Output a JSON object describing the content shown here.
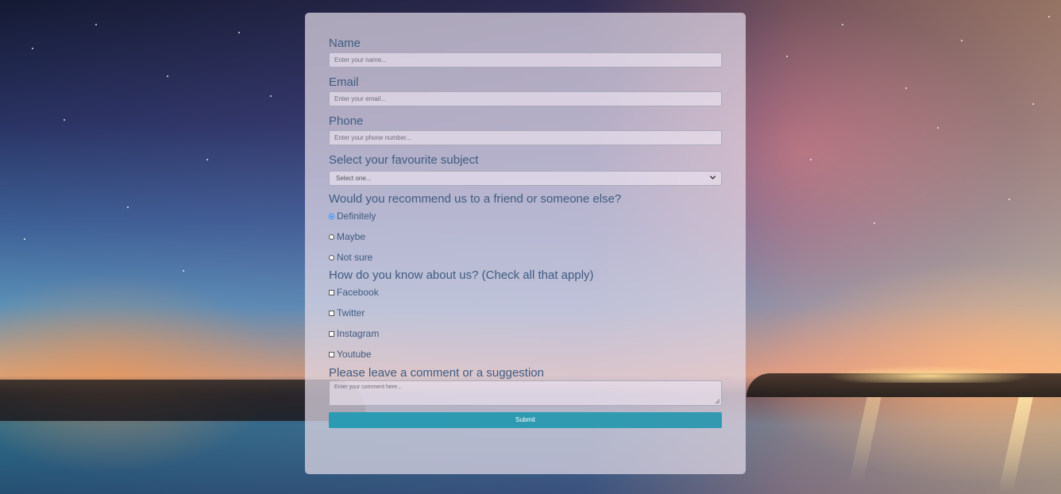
{
  "form": {
    "name": {
      "label": "Name",
      "placeholder": "Enter your name..."
    },
    "email": {
      "label": "Email",
      "placeholder": "Enter your email..."
    },
    "phone": {
      "label": "Phone",
      "placeholder": "Enter your phone number..."
    },
    "subject": {
      "label": "Select your favourite subject",
      "selected": "Select one..."
    },
    "recommend": {
      "question": "Would you recommend us to a friend or someone else?",
      "options": [
        {
          "label": "Definitely",
          "checked": true
        },
        {
          "label": "Maybe",
          "checked": false
        },
        {
          "label": "Not sure",
          "checked": false
        }
      ]
    },
    "source": {
      "question": "How do you know about us? (Check all that apply)",
      "options": [
        {
          "label": "Facebook",
          "checked": false
        },
        {
          "label": "Twitter",
          "checked": false
        },
        {
          "label": "Instagram",
          "checked": false
        },
        {
          "label": "Youtube",
          "checked": false
        }
      ]
    },
    "comment": {
      "label": "Please leave a comment or a suggestion",
      "placeholder": "Enter your comment here..."
    },
    "submit_label": "Submit"
  },
  "colors": {
    "label_text": "#3f5b80",
    "submit_bg": "#2a9bb3",
    "radio_checked": "#1a73e8"
  }
}
